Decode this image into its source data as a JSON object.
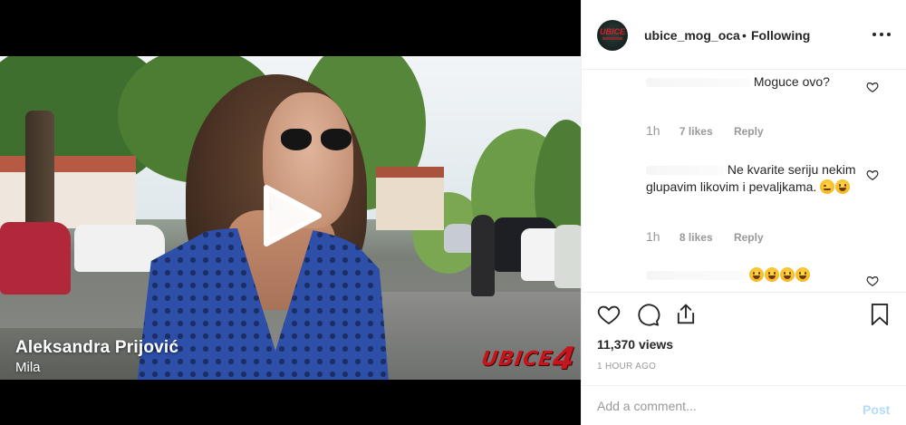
{
  "video": {
    "caption_name": "Aleksandra Prijović",
    "caption_role": "Mila",
    "brand_text": "UBICE",
    "brand_number": "4",
    "play_icon": "play-icon"
  },
  "post": {
    "username": "ubice_mog_oca",
    "separator": "•",
    "follow_state": "Following",
    "more_icon": "more-horizontal-icon"
  },
  "comments": [
    {
      "text": "Moguce ovo?",
      "emojis": [],
      "time": "1h",
      "likes": "7 likes",
      "reply": "Reply"
    },
    {
      "text": "Ne kvarite seriju nekim glupavim likovim i pevaljkama.",
      "emojis": [
        "smirk-emoji",
        "grin-emoji"
      ],
      "time": "1h",
      "likes": "8 likes",
      "reply": "Reply"
    },
    {
      "text": "",
      "emojis": [
        "laugh-emoji",
        "laugh-emoji",
        "laugh-emoji",
        "laugh-emoji"
      ],
      "time": "",
      "likes": "",
      "reply": ""
    }
  ],
  "actions": {
    "like_icon": "heart-icon",
    "comment_icon": "comment-icon",
    "share_icon": "share-icon",
    "save_icon": "bookmark-icon"
  },
  "stats": {
    "views": "11,370 views",
    "timestamp": "1 HOUR AGO"
  },
  "composer": {
    "placeholder": "Add a comment...",
    "post_label": "Post"
  },
  "colors": {
    "brand_red": "#c4161c",
    "text": "#262626",
    "muted": "#999999",
    "post_disabled": "#b3dbff"
  }
}
